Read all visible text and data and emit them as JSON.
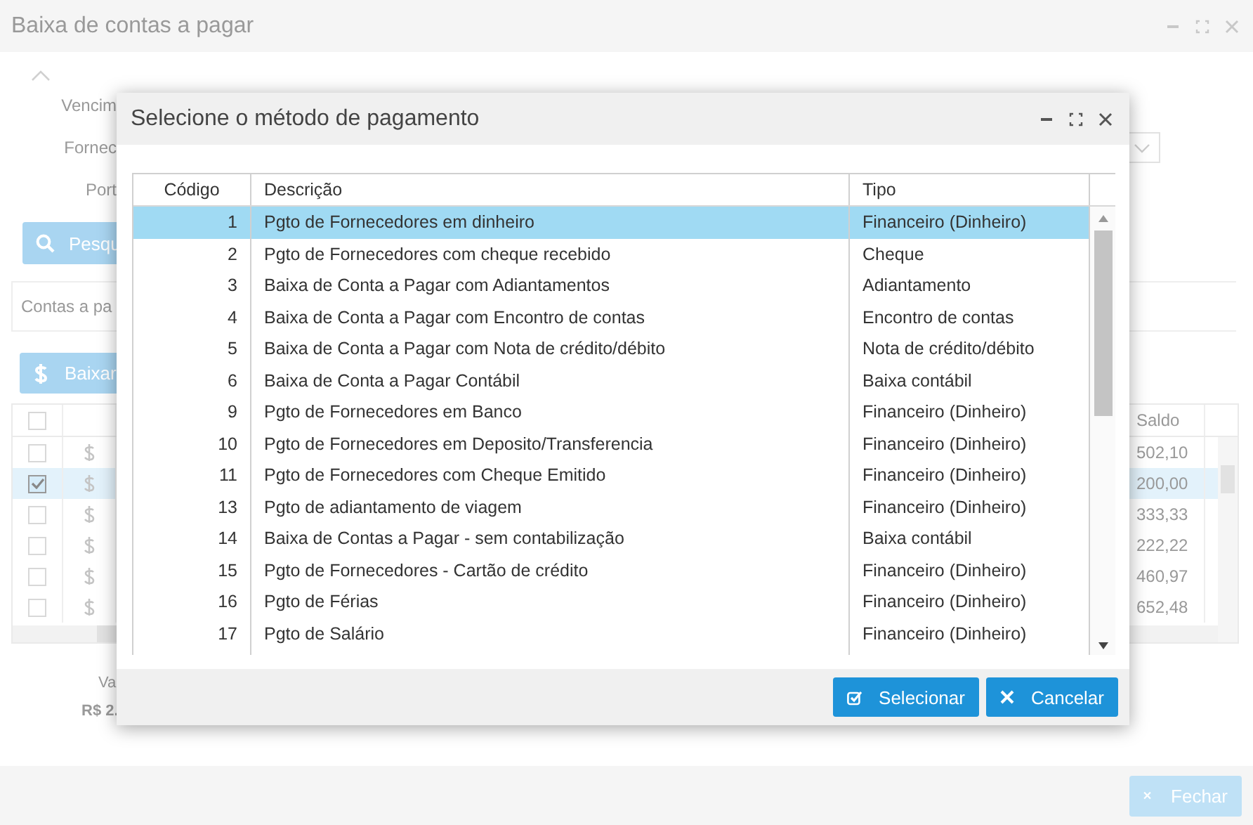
{
  "window": {
    "title": "Baixa de contas a pagar",
    "filter_labels": [
      "Vencim",
      "Fornec",
      "Port"
    ],
    "search_button": "Pesqu",
    "panel_tab": "Contas a pa",
    "pay_button": "Baixar",
    "grid": {
      "columns": [
        "Saldo"
      ],
      "select_all_checked": false,
      "rows": [
        {
          "checked": false,
          "selected": false,
          "saldo": "502,10"
        },
        {
          "checked": true,
          "selected": true,
          "saldo": "200,00"
        },
        {
          "checked": false,
          "selected": false,
          "saldo": "333,33"
        },
        {
          "checked": false,
          "selected": false,
          "saldo": "222,22"
        },
        {
          "checked": false,
          "selected": false,
          "saldo": "460,97"
        },
        {
          "checked": false,
          "selected": false,
          "saldo": "652,48"
        }
      ]
    },
    "total_label": "Va",
    "total_value": "R$ 2.",
    "close_button": "Fechar"
  },
  "dialog": {
    "title": "Selecione o método de pagamento",
    "columns": [
      "Código",
      "Descrição",
      "Tipo"
    ],
    "rows": [
      {
        "code": "1",
        "description": "Pgto de Fornecedores em dinheiro",
        "type": "Financeiro (Dinheiro)",
        "selected": true
      },
      {
        "code": "2",
        "description": "Pgto de Fornecedores com cheque recebido",
        "type": "Cheque",
        "selected": false
      },
      {
        "code": "3",
        "description": "Baixa de Conta a Pagar com Adiantamentos",
        "type": "Adiantamento",
        "selected": false
      },
      {
        "code": "4",
        "description": "Baixa de Conta a Pagar com Encontro de contas",
        "type": "Encontro de contas",
        "selected": false
      },
      {
        "code": "5",
        "description": "Baixa de Conta a Pagar com Nota de crédito/débito",
        "type": "Nota de crédito/débito",
        "selected": false
      },
      {
        "code": "6",
        "description": "Baixa de Conta a Pagar Contábil",
        "type": "Baixa contábil",
        "selected": false
      },
      {
        "code": "9",
        "description": "Pgto de Fornecedores em Banco",
        "type": "Financeiro (Dinheiro)",
        "selected": false
      },
      {
        "code": "10",
        "description": "Pgto de Fornecedores em Deposito/Transferencia",
        "type": "Financeiro (Dinheiro)",
        "selected": false
      },
      {
        "code": "11",
        "description": "Pgto de Fornecedores com Cheque Emitido",
        "type": "Financeiro (Dinheiro)",
        "selected": false
      },
      {
        "code": "13",
        "description": "Pgto de adiantamento de viagem",
        "type": "Financeiro (Dinheiro)",
        "selected": false
      },
      {
        "code": "14",
        "description": "Baixa de Contas a Pagar - sem contabilização",
        "type": "Baixa contábil",
        "selected": false
      },
      {
        "code": "15",
        "description": "Pgto de Fornecedores - Cartão de crédito",
        "type": "Financeiro (Dinheiro)",
        "selected": false
      },
      {
        "code": "16",
        "description": "Pgto de Férias",
        "type": "Financeiro (Dinheiro)",
        "selected": false
      },
      {
        "code": "17",
        "description": "Pgto de Salário",
        "type": "Financeiro (Dinheiro)",
        "selected": false
      }
    ],
    "buttons": [
      {
        "kind": "confirm",
        "label": "Selecionar"
      },
      {
        "kind": "cancel",
        "label": "Cancelar"
      }
    ]
  }
}
